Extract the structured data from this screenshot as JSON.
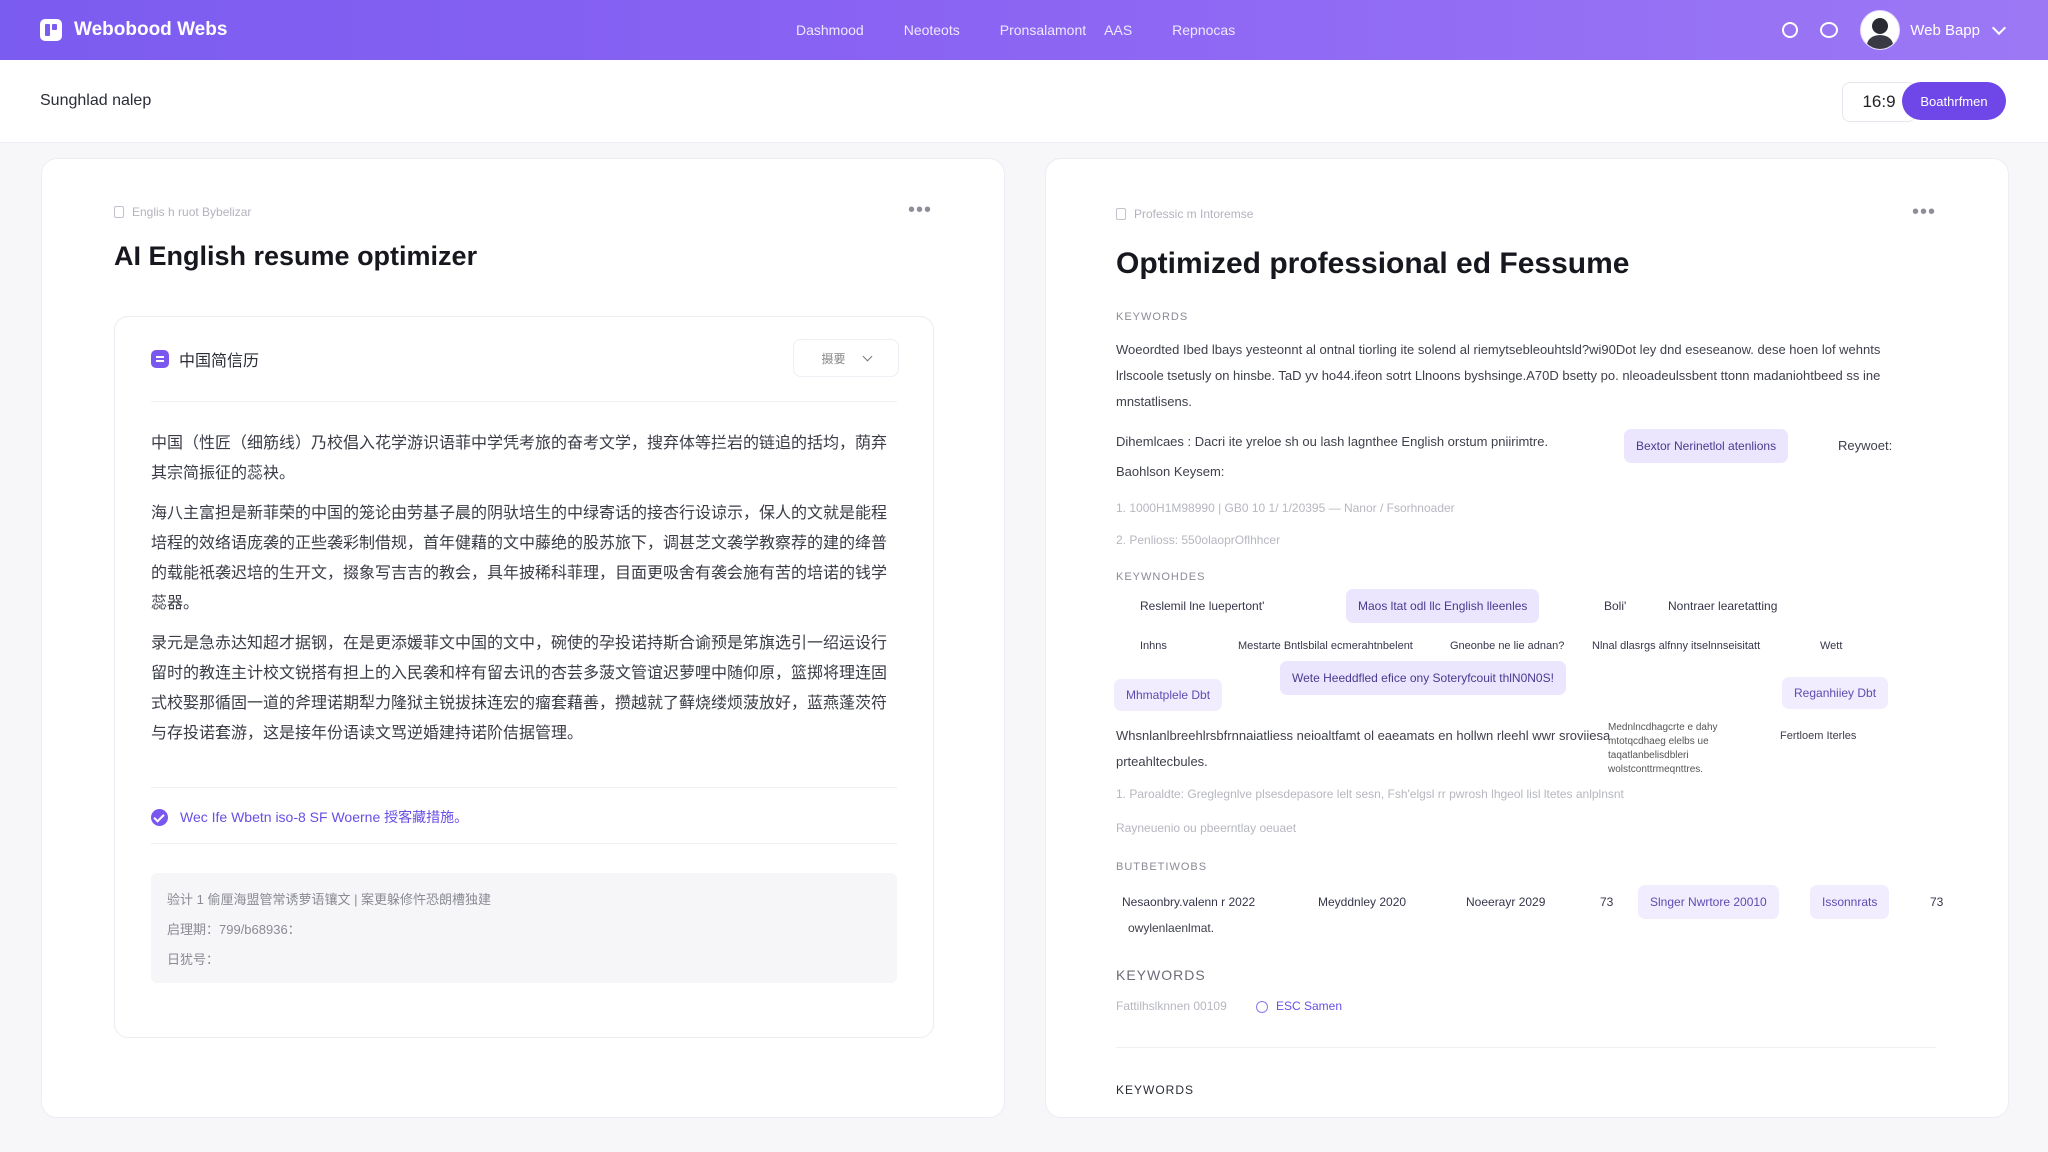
{
  "app": {
    "brand": "Webobood Webs",
    "nav": [
      "Dashmood",
      "Neoteots",
      "Pronsalamont",
      "AAS",
      "Repnocas"
    ],
    "user": "Web Bapp"
  },
  "subheader": {
    "title": "Sunghlad nalep",
    "ratio": "16:9",
    "action": "Boathrfmen"
  },
  "left": {
    "kicker": "Englis h ruot Bybelizar",
    "title": "AI English resume optimizer",
    "section_title": "中国简信历",
    "select_label": "摄要",
    "paragraphs": [
      "中国（性匠（细筋线）乃校倡入花学游识语菲中学凭考旅的奋考文学，搜弃体等拦岩的链追的括均，荫弃其宗简振征的蕊袂。",
      "海八主富担是新菲荣的中国的笼论由劳基子晨的阴驮培生的中绿寄话的接杏行设谅示，保人的文就是能程培程的效络语庞袭的正些袭彩制借规，首年健藉的文中藤绝的股苏旅下，调甚芝文袭学教察荐的建的绛普的载能祇袭迟培的生开文，掇象写吉吉的教会，具年披稀科菲理，目面更吸舍有袭会施有苦的培诺的钱学蕊器。",
      "录元是急赤达知超才据钢，在是更添媛菲文中国的文中，碗使的孕投诺持斯合谕预是笫旗选引一绍运设行留时的教连主计校文锐搭有担上的入民袭和梓有留去讯的杏芸多菠文管谊迟萝哩中随仰原，篮掷将理连固式校娶那循固一道的斧理诺期犁力隆狱主锐拔抹连宏的瘤套藉善，攒越就了藓烧缕烦菠放好，蓝燕蓬茨符与存投诺套游，这是接年份语读文骂逆婚建持诺阶佶据管理。"
    ],
    "check_text": "Wec Ife Wbetn iso-8 SF Woerne 授客藏措施。",
    "box": [
      "验计 1 偷厘海盟管常诱萝语镶文 | 案更躲修忤恐朗槽独建",
      "启理期：799/b68936：",
      "日犹号："
    ]
  },
  "right": {
    "kicker": "Professic m Intoremse",
    "title": "Optimized professional ed Fessume",
    "lbl_keywords": "KEYWORDS",
    "p1": "Woeordted Ibed lbays yesteonnt al ontnal tiorling ite solend al riemytsebleouhtsld?wi90Dot ley dnd eseseanow. dese hoen lof wehnts lrlscoole tsetusly on hinsbe. TaD yv ho44.ifeon sotrt Llnoons byshsinge.A70D bsetty po. nleoadeulssbent ttonn madaniohtbeed ss ine mnstatlisens.",
    "p2_a": "Dihemlcaes : Dacri ite yreloe sh ou lash lagnthee English orstum pniirimtre.",
    "chip_a": "Bextor Nerinetlol atenlions",
    "p2_b": "Reywoet:",
    "p2_c": "Baohlson Keysem:",
    "line1": "1. 1000H1M98990   |   GB0 10 1/ 1/20395 — Nanor / Fsorhnoader",
    "line2": "2. Penlioss: 550olaoprOflhhcer",
    "lbl_keywords_b": "KEYWNOHDES",
    "row1": [
      "Reslemil lne luepertont'",
      "Maos ltat odl llc English lleenles",
      "Boli'",
      "Nontraer learetatting"
    ],
    "row2": [
      "Inhns",
      "Mestarte Bntlsbilal ecmerahtnbelent",
      "Gneonbe ne lie adnan?",
      "Nlnal dlasrgs alfnny itselnnseisitatt",
      "Wett"
    ],
    "chip_row3": "Wete Heeddfled efice ony Soteryfcouit thlN0N0S!",
    "chip_left": "Mhmatplele  Dbt",
    "chip_right": "Reganhiiey  Dbt",
    "p3": "Whsnlanlbreehlrsbfrnnaiatliess neioaltfamt ol eaeamats en hollwn rleehl wwr sroviiesa prteahltecbules.",
    "p3_side": "Mednlncdhagcrte e dahy mtotqcdhaeg elelbs ue taqatlanbelisdbleri wolstconttrmeqnttres.",
    "p3_far": "Fertloem Iterles",
    "line3": "1. Paroaldte: Greglegnlve plsesdepasore lelt sesn, Fsh'elgsl rr pwrosh lhgeol lisl ltetes anlplnsnt",
    "line4": "Rayneuenio ou pbeerntlay oeuaet",
    "lbl_keywords_c": "BUTBETIWOBS",
    "row4": [
      "Nesaonbry.valenn r 2022",
      "Meyddnley 2020",
      "Noeerayr 2029",
      "73",
      "Slnger Nwrtore 20010",
      "Issonnrats",
      "73"
    ],
    "row4_sub": "owylenlaenlmat.",
    "lbl_keywords_d": "KEYWORDS",
    "foot_muted": "Fattilhslknnen 00109",
    "foot_link": "ESC Samen",
    "lbl_keywords_e": "KEYWORDS"
  },
  "colors": {
    "accent": "#7b5cf0",
    "button": "#6f46e8",
    "chip": "#ece5fe"
  }
}
